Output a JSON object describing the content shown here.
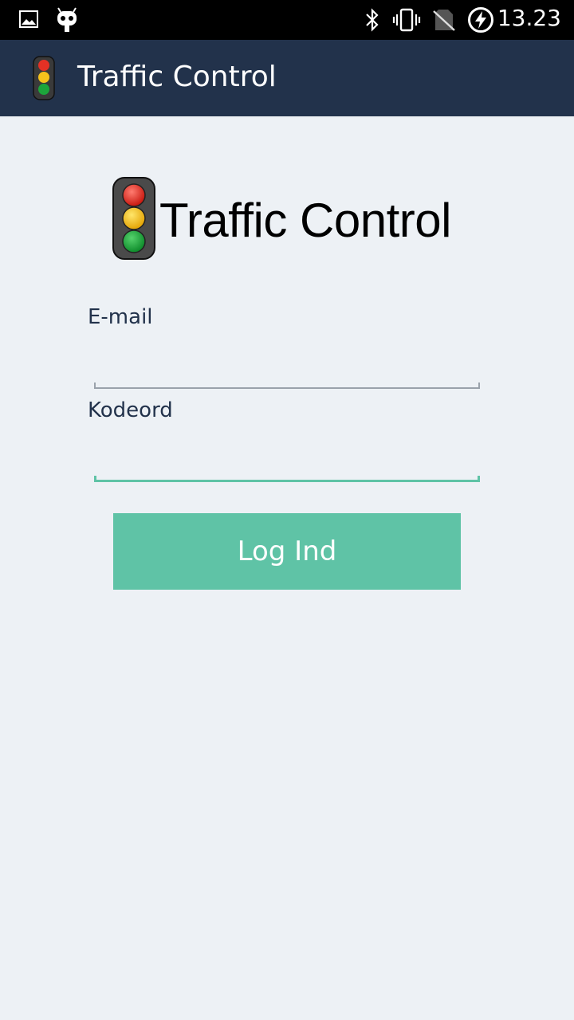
{
  "status_bar": {
    "time": "13.23",
    "left_icons": [
      "image-icon",
      "android-debug-icon"
    ],
    "right_icons": [
      "bluetooth-icon",
      "vibrate-icon",
      "no-sim-icon",
      "battery-charging-icon"
    ]
  },
  "app_bar": {
    "title": "Traffic Control",
    "icon": "traffic-light-icon"
  },
  "logo": {
    "text": "Traffic Control",
    "icon": "traffic-light-icon"
  },
  "form": {
    "email_label": "E-mail",
    "email_value": "",
    "password_label": "Kodeord",
    "password_value": "",
    "submit_label": "Log Ind"
  },
  "colors": {
    "app_bar": "#22324b",
    "background": "#edf1f5",
    "accent": "#5fc3a6"
  }
}
